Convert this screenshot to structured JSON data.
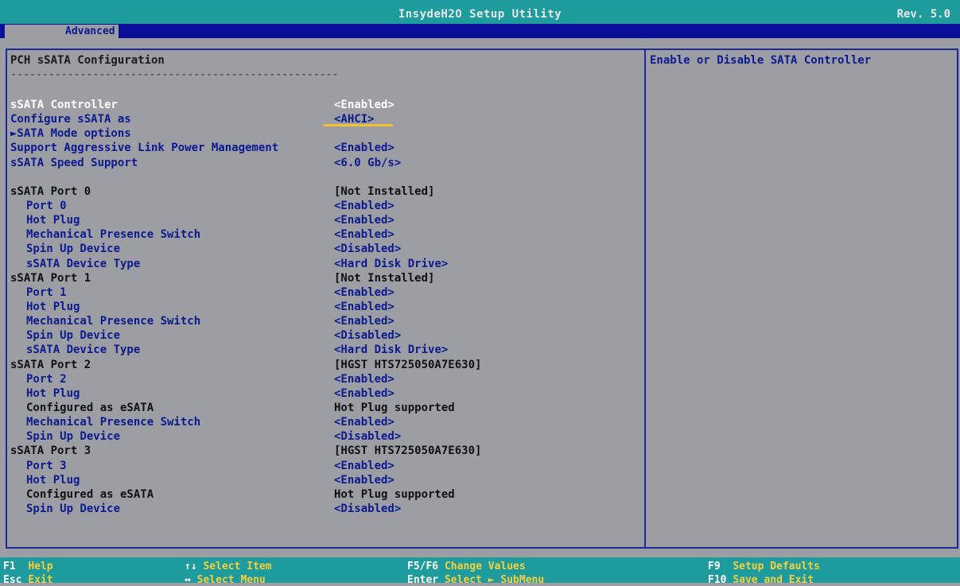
{
  "header": {
    "title": "InsydeH2O Setup Utility",
    "revision": "Rev. 5.0",
    "active_tab": "Advanced"
  },
  "panel": {
    "title": "PCH sSATA Configuration",
    "dashes": "----------------------------------------------------"
  },
  "help": {
    "text": "Enable or Disable SATA Controller"
  },
  "settings": [
    {
      "label": "sSATA Controller",
      "value": "<Enabled>",
      "indent": false,
      "color": "white"
    },
    {
      "label": "Configure sSATA as",
      "value": "<AHCI>",
      "indent": false,
      "color": "blue"
    },
    {
      "label": "►SATA Mode options",
      "value": "",
      "indent": false,
      "color": "blue"
    },
    {
      "label": "Support Aggressive Link Power Management",
      "value": "<Enabled>",
      "indent": false,
      "color": "blue"
    },
    {
      "label": "sSATA Speed Support",
      "value": "<6.0 Gb/s>",
      "indent": false,
      "color": "blue"
    },
    {
      "label": "",
      "value": "",
      "indent": false,
      "color": "blue"
    },
    {
      "label": "sSATA Port 0",
      "value": "[Not Installed]",
      "indent": false,
      "color": "black"
    },
    {
      "label": "Port 0",
      "value": "<Enabled>",
      "indent": true,
      "color": "blue"
    },
    {
      "label": "Hot Plug",
      "value": "<Enabled>",
      "indent": true,
      "color": "blue"
    },
    {
      "label": "Mechanical Presence Switch",
      "value": "<Enabled>",
      "indent": true,
      "color": "blue"
    },
    {
      "label": "Spin Up Device",
      "value": "<Disabled>",
      "indent": true,
      "color": "blue"
    },
    {
      "label": "sSATA Device Type",
      "value": "<Hard Disk Drive>",
      "indent": true,
      "color": "blue"
    },
    {
      "label": "sSATA Port 1",
      "value": "[Not Installed]",
      "indent": false,
      "color": "black"
    },
    {
      "label": "Port 1",
      "value": "<Enabled>",
      "indent": true,
      "color": "blue"
    },
    {
      "label": "Hot Plug",
      "value": "<Enabled>",
      "indent": true,
      "color": "blue"
    },
    {
      "label": "Mechanical Presence Switch",
      "value": "<Enabled>",
      "indent": true,
      "color": "blue"
    },
    {
      "label": "Spin Up Device",
      "value": "<Disabled>",
      "indent": true,
      "color": "blue"
    },
    {
      "label": "sSATA Device Type",
      "value": "<Hard Disk Drive>",
      "indent": true,
      "color": "blue"
    },
    {
      "label": "sSATA Port 2",
      "value": "[HGST HTS725050A7E630]",
      "indent": false,
      "color": "black"
    },
    {
      "label": "Port 2",
      "value": "<Enabled>",
      "indent": true,
      "color": "blue"
    },
    {
      "label": "Hot Plug",
      "value": "<Enabled>",
      "indent": true,
      "color": "blue"
    },
    {
      "label": "Configured as eSATA",
      "value": "Hot Plug supported",
      "indent": true,
      "color": "black"
    },
    {
      "label": "Mechanical Presence Switch",
      "value": "<Enabled>",
      "indent": true,
      "color": "blue"
    },
    {
      "label": "Spin Up Device",
      "value": "<Disabled>",
      "indent": true,
      "color": "blue"
    },
    {
      "label": "sSATA Port 3",
      "value": "[HGST HTS725050A7E630]",
      "indent": false,
      "color": "black"
    },
    {
      "label": "Port 3",
      "value": "<Enabled>",
      "indent": true,
      "color": "blue"
    },
    {
      "label": "Hot Plug",
      "value": "<Enabled>",
      "indent": true,
      "color": "blue"
    },
    {
      "label": "Configured as eSATA",
      "value": "Hot Plug supported",
      "indent": true,
      "color": "black"
    },
    {
      "label": "Spin Up Device",
      "value": "<Disabled>",
      "indent": true,
      "color": "blue"
    }
  ],
  "footer": {
    "f1_key": "F1",
    "f1_desc": "Help",
    "esc_key": "Esc",
    "esc_desc": "Exit",
    "updown_key": "↑↓",
    "updown_desc": "Select Item",
    "lr_key": "↔",
    "lr_desc": "Select Menu",
    "f5f6_key": "F5/F6",
    "f5f6_desc": "Change Values",
    "enter_key": "Enter",
    "enter_desc": "Select ► SubMenu",
    "f9_key": "F9",
    "f9_desc": "Setup Defaults",
    "f10_key": "F10",
    "f10_desc": "Save and Exit"
  },
  "colors": {
    "background": "#9c9ea4",
    "title_bar": "#1e9b9d",
    "menu_bar": "#0a0f99",
    "text_blue": "#0b1a8e",
    "highlight_underline": "#f2c230"
  }
}
